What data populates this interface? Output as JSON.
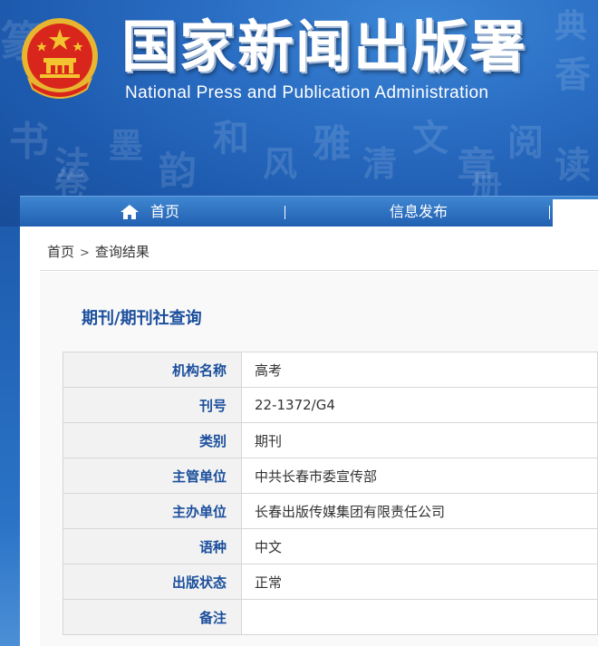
{
  "header": {
    "title_cn": "国家新闻出版署",
    "title_en": "National  Press and Publication Administration"
  },
  "nav": {
    "home": "首页",
    "info": "信息发布"
  },
  "breadcrumb": {
    "home": "首页",
    "separator": ">",
    "current": "查询结果"
  },
  "panel": {
    "title": "期刊/期刊社查询"
  },
  "table": {
    "rows": [
      {
        "label": "机构名称",
        "value": "高考"
      },
      {
        "label": "刊号",
        "value": "22-1372/G4"
      },
      {
        "label": "类别",
        "value": "期刊"
      },
      {
        "label": "主管单位",
        "value": "中共长春市委宣传部"
      },
      {
        "label": "主办单位",
        "value": "长春出版传媒集团有限责任公司"
      },
      {
        "label": "语种",
        "value": "中文"
      },
      {
        "label": "出版状态",
        "value": "正常"
      },
      {
        "label": "备注",
        "value": ""
      }
    ]
  },
  "colors": {
    "header_blue": "#2a6ec4",
    "label_blue": "#1a4e9c",
    "emblem_red": "#d9261c",
    "emblem_gold": "#f4c430"
  }
}
